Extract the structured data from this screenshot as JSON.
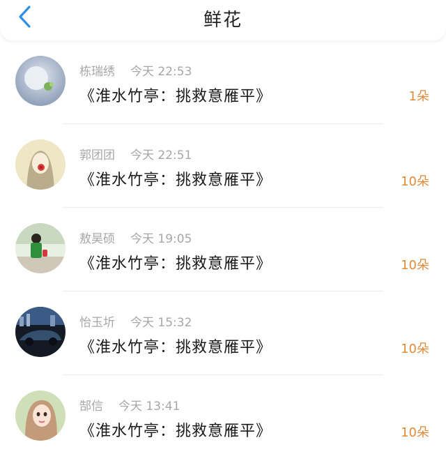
{
  "header": {
    "title": "鲜花"
  },
  "gifts": [
    {
      "user": "栋瑞绣",
      "time": "今天 22:53",
      "work": "《淮水竹亭：挑救意雁平》",
      "count": "1朵"
    },
    {
      "user": "郭团团",
      "time": "今天 22:51",
      "work": "《淮水竹亭：挑救意雁平》",
      "count": "10朵"
    },
    {
      "user": "敖昊硕",
      "time": "今天 19:05",
      "work": "《淮水竹亭：挑救意雁平》",
      "count": "10朵"
    },
    {
      "user": "怡玉圻",
      "time": "今天 15:32",
      "work": "《淮水竹亭：挑救意雁平》",
      "count": "10朵"
    },
    {
      "user": "郜信",
      "time": "今天 13:41",
      "work": "《淮水竹亭：挑救意雁平》",
      "count": "10朵"
    }
  ],
  "colors": {
    "accent_back": "#2f8ee5",
    "count_orange": "#e08a3a"
  }
}
